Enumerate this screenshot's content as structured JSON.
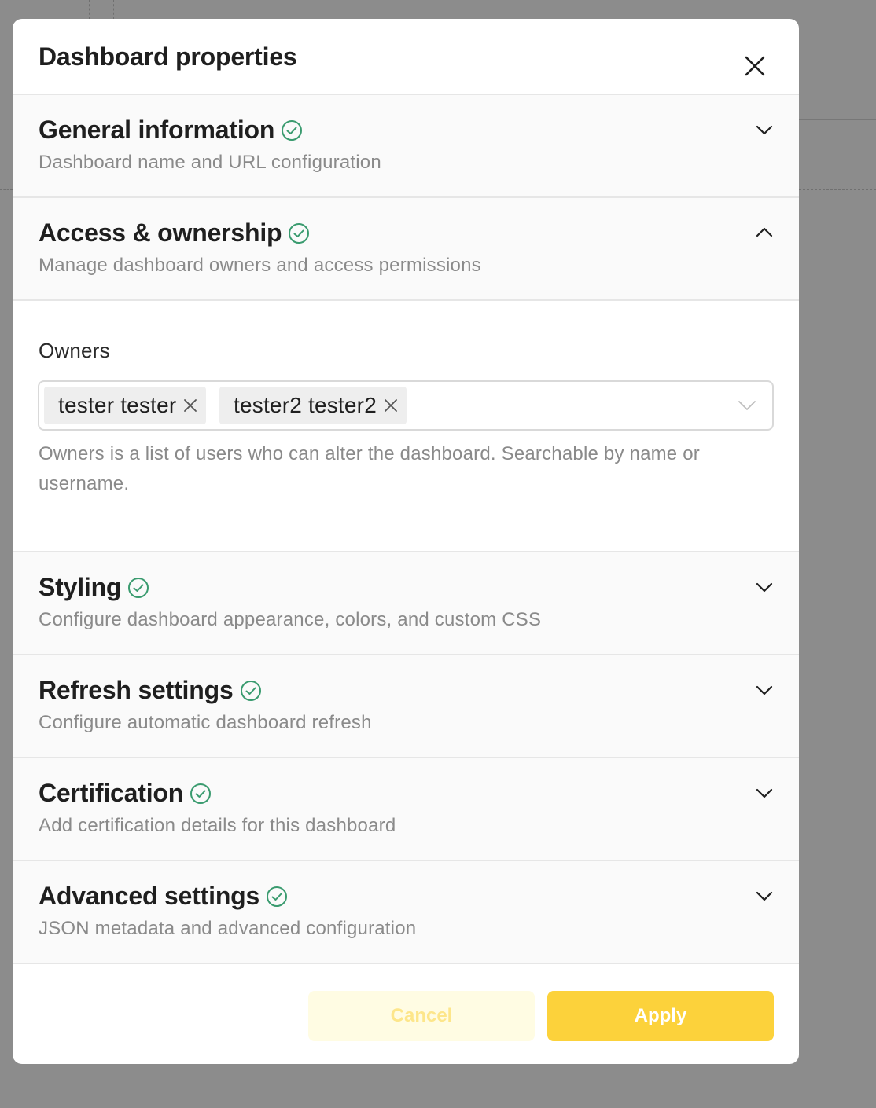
{
  "modal": {
    "title": "Dashboard properties"
  },
  "sections": [
    {
      "title": "General information",
      "description": "Dashboard name and URL configuration",
      "expanded": false
    },
    {
      "title": "Access & ownership",
      "description": "Manage dashboard owners and access permissions",
      "expanded": true
    },
    {
      "title": "Styling",
      "description": "Configure dashboard appearance, colors, and custom CSS",
      "expanded": false
    },
    {
      "title": "Refresh settings",
      "description": "Configure automatic dashboard refresh",
      "expanded": false
    },
    {
      "title": "Certification",
      "description": "Add certification details for this dashboard",
      "expanded": false
    },
    {
      "title": "Advanced settings",
      "description": "JSON metadata and advanced configuration",
      "expanded": false
    }
  ],
  "owners": {
    "label": "Owners",
    "tags": [
      "tester tester",
      "tester2 tester2"
    ],
    "help": "Owners is a list of users who can alter the dashboard. Searchable by name or username."
  },
  "footer": {
    "cancel_label": "Cancel",
    "apply_label": "Apply"
  },
  "colors": {
    "check": "#3a9b6f",
    "apply": "#fcd23b",
    "cancel_bg": "#fffce3"
  },
  "icons": {
    "close": "close-icon",
    "check": "check-circle-icon",
    "chevron_down": "chevron-down-icon",
    "chevron_up": "chevron-up-icon"
  }
}
